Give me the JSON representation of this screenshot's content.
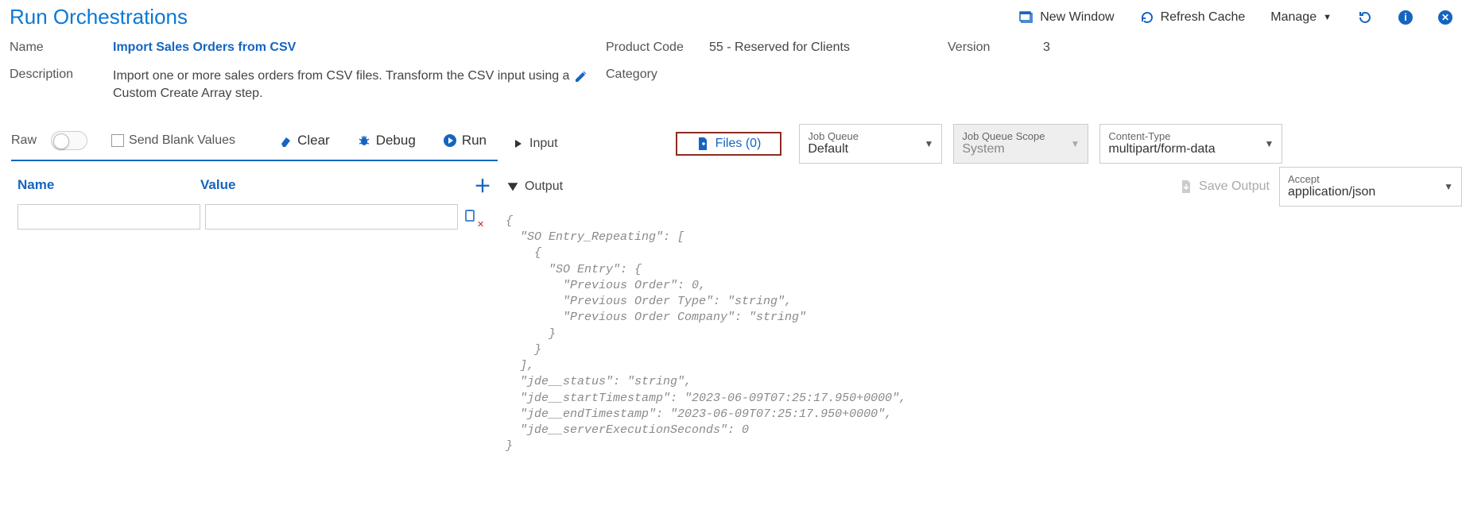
{
  "header": {
    "title": "Run Orchestrations",
    "new_window": "New Window",
    "refresh_cache": "Refresh Cache",
    "manage": "Manage"
  },
  "meta": {
    "name_label": "Name",
    "name_value": "Import Sales Orders from CSV",
    "desc_label": "Description",
    "desc_value": "Import one or more sales orders from CSV files. Transform the CSV input using a Custom Create Array step.",
    "product_code_label": "Product Code",
    "product_code_value": "55 - Reserved for Clients",
    "version_label": "Version",
    "version_value": "3",
    "category_label": "Category"
  },
  "toolbar": {
    "raw_label": "Raw",
    "send_blank": "Send Blank Values",
    "clear": "Clear",
    "debug": "Debug",
    "run": "Run"
  },
  "columns": {
    "name": "Name",
    "value": "Value"
  },
  "tabs": {
    "input": "Input",
    "files": "Files (0)",
    "output": "Output",
    "save_output": "Save Output"
  },
  "selectors": {
    "job_queue_label": "Job Queue",
    "job_queue_value": "Default",
    "job_queue_scope_label": "Job Queue Scope",
    "job_queue_scope_value": "System",
    "content_type_label": "Content-Type",
    "content_type_value": "multipart/form-data",
    "accept_label": "Accept",
    "accept_value": "application/json"
  },
  "output_json": "{\n  \"SO Entry_Repeating\": [\n    {\n      \"SO Entry\": {\n        \"Previous Order\": 0,\n        \"Previous Order Type\": \"string\",\n        \"Previous Order Company\": \"string\"\n      }\n    }\n  ],\n  \"jde__status\": \"string\",\n  \"jde__startTimestamp\": \"2023-06-09T07:25:17.950+0000\",\n  \"jde__endTimestamp\": \"2023-06-09T07:25:17.950+0000\",\n  \"jde__serverExecutionSeconds\": 0\n}"
}
